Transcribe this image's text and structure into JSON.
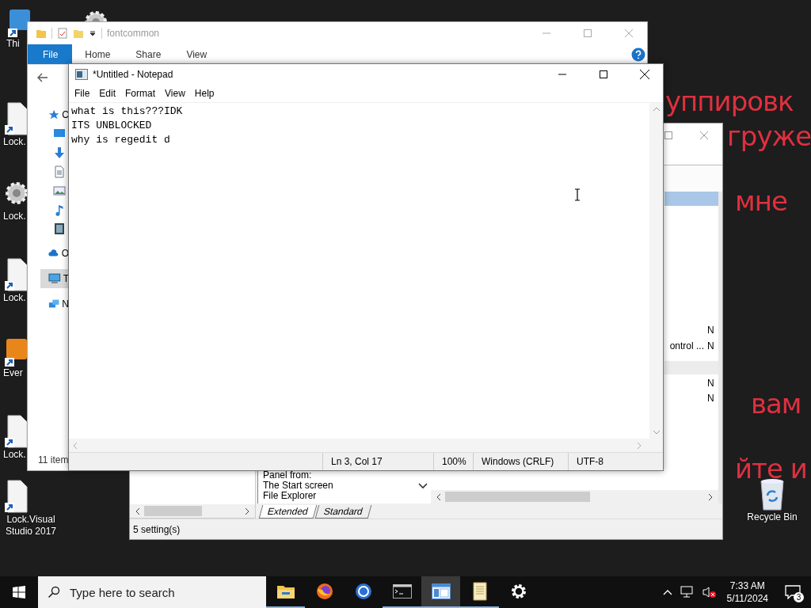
{
  "desktop": {
    "background_text": [
      "уппировк",
      "груже",
      "мне",
      "вам",
      "йте и"
    ],
    "icons": [
      {
        "kind": "app",
        "label": "Thi"
      },
      {
        "kind": "gear"
      },
      {
        "kind": "document",
        "label": "Lock."
      },
      {
        "kind": "gear",
        "label": "Lock."
      },
      {
        "kind": "document",
        "label": "Lock."
      },
      {
        "kind": "app",
        "label": "Ever"
      },
      {
        "kind": "document",
        "label": "Lock."
      },
      {
        "kind": "document",
        "label": "Lock.Visual Studio 2017"
      },
      {
        "kind": "recycle",
        "label": "Recycle Bin"
      }
    ]
  },
  "explorer": {
    "title": "fontcommon",
    "ribbon_tabs": [
      {
        "label": "File",
        "selected": true
      },
      {
        "label": "Home",
        "selected": false
      },
      {
        "label": "Share",
        "selected": false
      },
      {
        "label": "View",
        "selected": false
      }
    ],
    "nav_items": [
      {
        "kind": "star",
        "label": "C",
        "selected": false
      },
      {
        "kind": "desktop",
        "selected": false
      },
      {
        "kind": "download",
        "selected": false
      },
      {
        "kind": "document",
        "selected": false
      },
      {
        "kind": "pictures",
        "selected": false
      },
      {
        "kind": "music",
        "selected": false
      },
      {
        "kind": "video",
        "selected": false
      },
      {
        "kind": "cloud",
        "label": "O",
        "selected": false
      },
      {
        "kind": "computer",
        "label": "T",
        "selected": true
      },
      {
        "kind": "network",
        "label": "N",
        "selected": false
      }
    ],
    "status": "11 item"
  },
  "policy_editor": {
    "list_rows": [
      {
        "kind": "row",
        "selected": true
      },
      {
        "kind": "row",
        "selected": false,
        "column_2": "N"
      },
      {
        "kind": "row",
        "selected": false,
        "column_1": "ontrol ...",
        "column_2": "N"
      },
      {
        "kind": "group",
        "selected": false
      },
      {
        "kind": "row",
        "selected": false,
        "column_2": "N"
      },
      {
        "kind": "row",
        "selected": false,
        "column_2": "N"
      }
    ],
    "description_lines": [
      "Panel from:",
      "The Start screen",
      "File Explorer"
    ],
    "tabs": [
      {
        "label": "Extended",
        "selected": true
      },
      {
        "label": "Standard",
        "selected": false
      }
    ],
    "status": "5 setting(s)"
  },
  "notepad": {
    "title": "*Untitled - Notepad",
    "menu": [
      "File",
      "Edit",
      "Format",
      "View",
      "Help"
    ],
    "lines": [
      "what is this???IDK",
      "ITS UNBLOCKED",
      "why is regedit d"
    ],
    "status": {
      "position": "Ln 3, Col 17",
      "zoom": "100%",
      "line_ending": "Windows (CRLF)",
      "encoding": "UTF-8"
    }
  },
  "taskbar": {
    "search": {
      "placeholder": "Type here to search"
    },
    "apps": [
      {
        "kind": "folder",
        "running": true,
        "selected": false
      },
      {
        "kind": "firefox",
        "running": false,
        "selected": false
      },
      {
        "kind": "browser",
        "running": false,
        "selected": false
      },
      {
        "kind": "terminal",
        "running": true,
        "selected": false
      },
      {
        "kind": "editor",
        "running": true,
        "selected": true
      },
      {
        "kind": "notepad",
        "running": true,
        "selected": false
      },
      {
        "kind": "settings",
        "running": false,
        "selected": false
      }
    ],
    "clock": {
      "time": "7:33 AM",
      "date": "5/11/2024"
    },
    "notifications": "3"
  }
}
